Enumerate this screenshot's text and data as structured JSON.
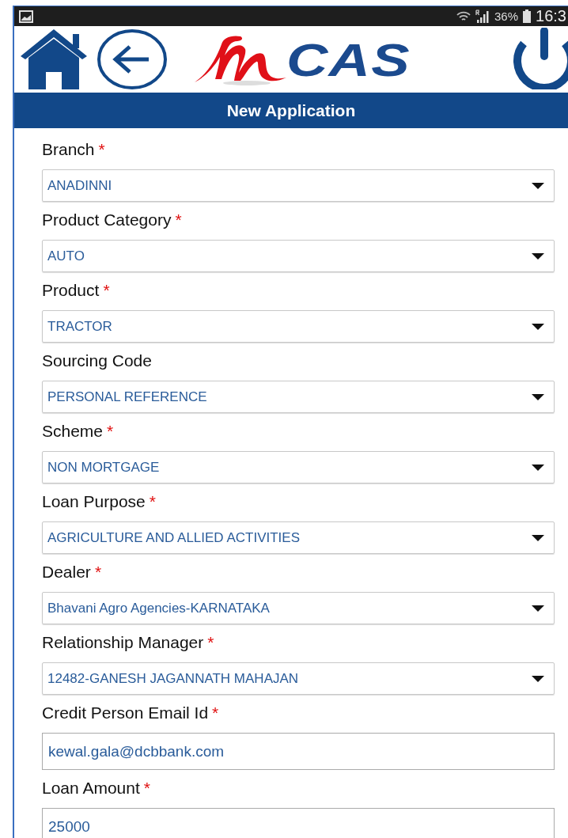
{
  "status_bar": {
    "battery": "36%",
    "time": "16:3"
  },
  "header": {
    "logo_text": "CAS"
  },
  "title_bar": {
    "title": "New Application"
  },
  "fields": [
    {
      "kind": "select",
      "label": "Branch",
      "required_mark": "*",
      "value": "ANADINNI"
    },
    {
      "kind": "select",
      "label": "Product Category",
      "required_mark": "*",
      "value": "AUTO"
    },
    {
      "kind": "select",
      "label": "Product",
      "required_mark": "*",
      "value": "TRACTOR"
    },
    {
      "kind": "select",
      "label": "Sourcing Code",
      "value": "PERSONAL REFERENCE"
    },
    {
      "kind": "select",
      "label": "Scheme",
      "required_mark": "*",
      "value": "NON MORTGAGE"
    },
    {
      "kind": "select",
      "label": "Loan Purpose",
      "required_mark": "*",
      "value": "AGRICULTURE AND ALLIED ACTIVITIES"
    },
    {
      "kind": "select",
      "label": "Dealer",
      "required_mark": "*",
      "value": "Bhavani Agro Agencies-KARNATAKA"
    },
    {
      "kind": "select",
      "label": "Relationship Manager",
      "required_mark": "*",
      "value": "12482-GANESH JAGANNATH MAHAJAN"
    },
    {
      "kind": "input",
      "label": "Credit Person Email Id",
      "required_mark": "*",
      "value": "kewal.gala@dcbbank.com"
    },
    {
      "kind": "input",
      "label": "Loan Amount",
      "required_mark": "*",
      "value": "25000"
    }
  ]
}
